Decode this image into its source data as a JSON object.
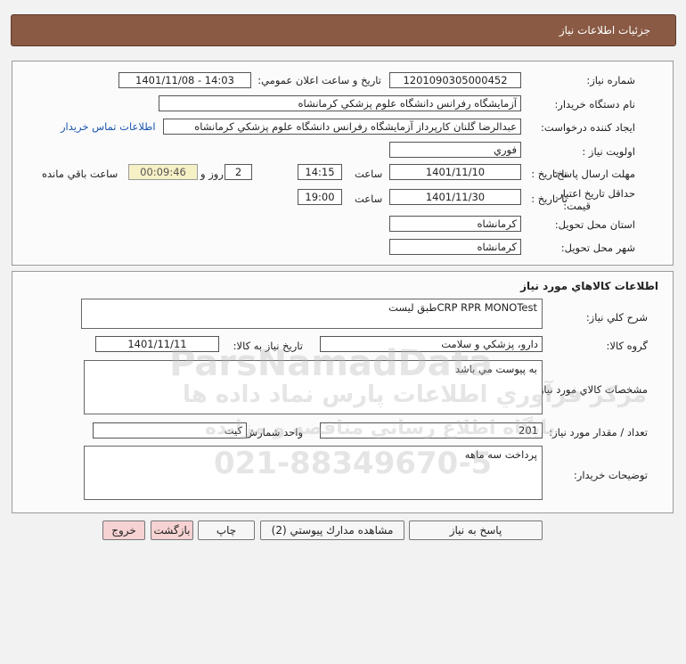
{
  "header": {
    "title": "جزئيات اطلاعات نياز"
  },
  "info": {
    "need_number_label": "شماره نياز:",
    "need_number": "1201090305000452",
    "announce_label": "تاريخ و ساعت اعلان عمومي:",
    "announce_value": "1401/11/08 - 14:03",
    "buyer_org_label": "نام دستگاه خريدار:",
    "buyer_org": "آزمايشگاه رفرانس دانشگاه علوم پزشكي كرمانشاه",
    "requester_label": "ايجاد كننده درخواست:",
    "requester": "عبدالرضا گلنان کارپرداز آزمايشگاه رفرانس دانشگاه علوم پزشكي كرمانشاه",
    "contact_link": "اطلاعات تماس خريدار",
    "priority_label": "اولويت نياز :",
    "priority": "فوري",
    "deadline_label": "مهلت ارسال پاسخ:",
    "deadline_to": "تا تاريخ :",
    "deadline_date": "1401/11/10",
    "time_label": "ساعت",
    "deadline_time": "14:15",
    "days_value": "2",
    "days_label": "روز و",
    "remaining_value": "00:09:46",
    "remaining_label": "ساعت باقي مانده",
    "validity_label_1": "حداقل تاريخ اعتبار",
    "validity_label_2": "قيمت:",
    "validity_to": "تا تاريخ :",
    "validity_date": "1401/11/30",
    "validity_time_label": "ساعت",
    "validity_time": "19:00",
    "province_label": "استان محل تحويل:",
    "province": "كرمانشاه",
    "city_label": "شهر محل تحويل:",
    "city": "كرمانشاه"
  },
  "goods": {
    "section_title": "اطلاعات كالاهاي مورد نياز",
    "summary_label": "شرح كلي نياز:",
    "summary": "CRP RPR MONOTestطبق ليست",
    "group_label": "گروه كالا:",
    "group": "دارو، پزشكي و سلامت",
    "need_date_label": "تاريخ نياز به كالا:",
    "need_date": "1401/11/11",
    "specs_label": "مشخصات كالاي مورد نياز:",
    "specs": "به پيوست مي باشد",
    "qty_label": "تعداد / مقدار مورد نياز:",
    "qty": "201",
    "unit_label": "واحد شمارش:",
    "unit": "كيت",
    "buyer_notes_label": "توضيحات خريدار:",
    "buyer_notes": "پرداخت سه ماهه"
  },
  "buttons": {
    "reply": "پاسخ به نياز",
    "docs": "مشاهده مدارك پيوستي (2)",
    "print": "چاپ",
    "back": "بازگشت",
    "exit": "خروج"
  },
  "watermark": {
    "brand": "ParsNamadData",
    "line1": "مركز فرآوري اطلاعات پارس نماد داده ها",
    "line2": "پايگاه اطلاع رساني مناقصه و مزايده",
    "phone": "021-88349670-5"
  }
}
